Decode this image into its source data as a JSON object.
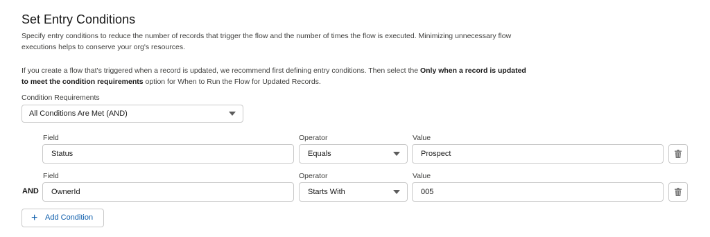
{
  "section": {
    "title": "Set Entry Conditions",
    "description": "Specify entry conditions to reduce the number of records that trigger the flow and the number of times the flow is executed. Minimizing unnecessary flow executions helps to conserve your org's resources.",
    "note_prefix": "If you create a flow that's triggered when a record is updated, we recommend first defining entry conditions. Then select the ",
    "note_bold": "Only when a record is updated to meet the condition requirements",
    "note_suffix": " option for When to Run the Flow for Updated Records."
  },
  "requirements": {
    "label": "Condition Requirements",
    "value": "All Conditions Are Met (AND)"
  },
  "conditions": [
    {
      "prefix": "",
      "field_label": "Field",
      "field": "Status",
      "operator_label": "Operator",
      "operator": "Equals",
      "value_label": "Value",
      "value": "Prospect"
    },
    {
      "prefix": "AND",
      "field_label": "Field",
      "field": "OwnerId",
      "operator_label": "Operator",
      "operator": "Starts With",
      "value_label": "Value",
      "value": "005"
    }
  ],
  "add_condition_label": "Add Condition",
  "icons": {
    "delete": "trash-icon",
    "add": "plus-icon",
    "dropdown": "chevron-down-icon"
  },
  "colors": {
    "accent": "#0b5cab",
    "border": "#c9c9c9",
    "text": "#3e3e3c"
  }
}
